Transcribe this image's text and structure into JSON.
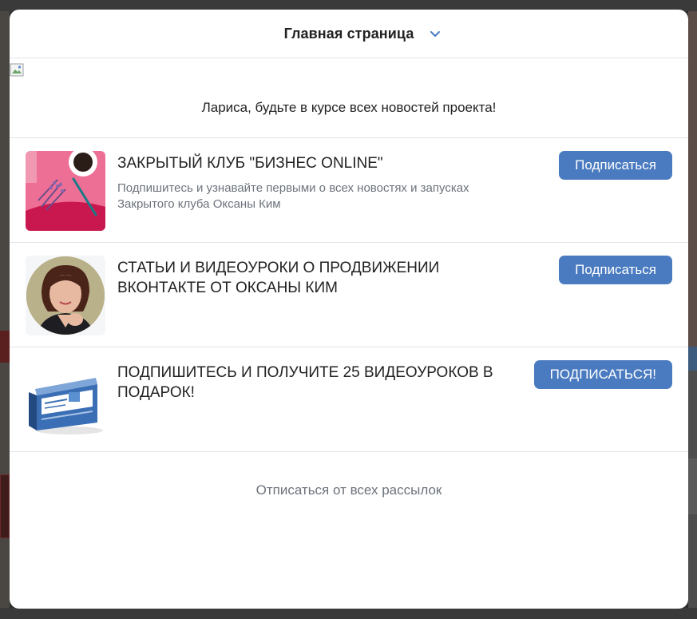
{
  "header": {
    "title": "Главная страница"
  },
  "greeting": "Лариса, будьте в курсе всех новостей проекта!",
  "groups": [
    {
      "title": "ЗАКРЫТЫЙ КЛУБ \"БИЗНЕС ONLINE\"",
      "description": "Подпишитесь и узнавайте первыми о всех новостях и запусках Закрытого клуба Оксаны Ким",
      "button_label": "Подписаться"
    },
    {
      "title": "СТАТЬИ И ВИДЕОУРОКИ О ПРОДВИЖЕНИИ ВКОНТАКТЕ ОТ ОКСАНЫ КИМ",
      "description": "",
      "button_label": "Подписаться"
    },
    {
      "title": "ПОДПИШИТЕСЬ И ПОЛУЧИТЕ 25 ВИДЕОУРОКОВ В ПОДАРОК!",
      "description": "",
      "button_label": "ПОДПИСАТЬСЯ!"
    }
  ],
  "unsubscribe_all": "Отписаться от всех рассылок",
  "colors": {
    "accent": "#4a7bc0",
    "muted_text": "#6c737c",
    "divider": "#e3e4e8"
  },
  "icons": [
    "chevron-down-icon",
    "broken-image-icon"
  ]
}
